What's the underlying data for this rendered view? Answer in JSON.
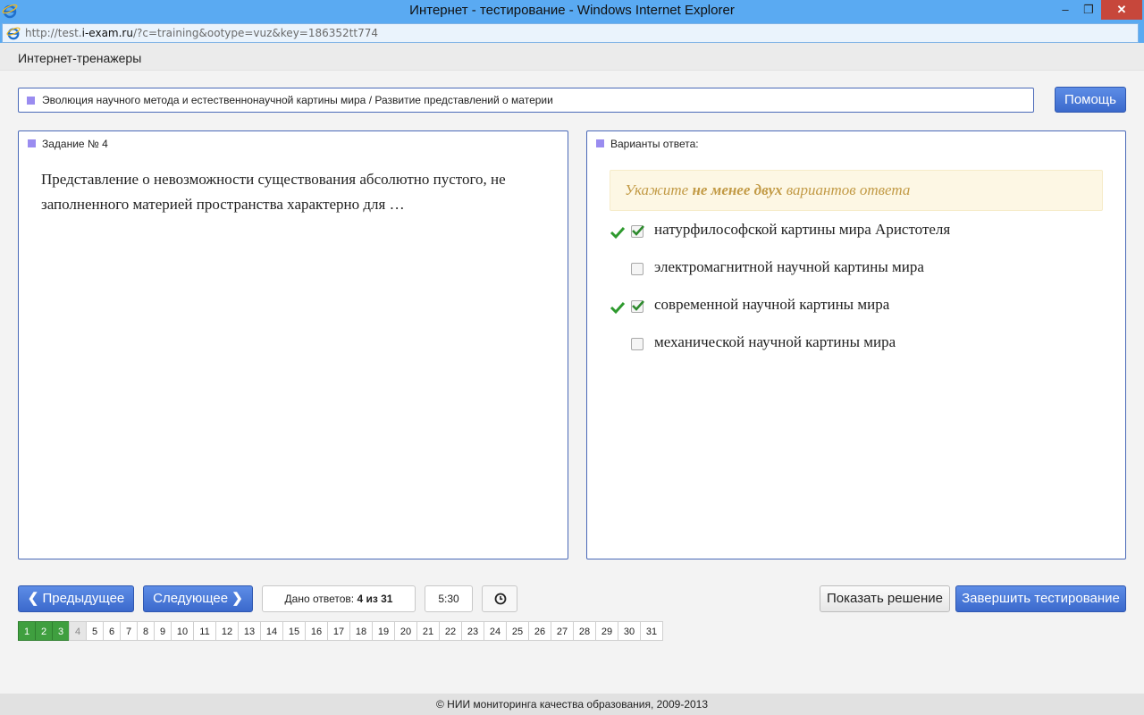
{
  "window": {
    "title": "Интернет - тестирование - Windows Internet Explorer",
    "minimize": "–",
    "maximize": "❐",
    "close": "✕"
  },
  "address": {
    "url_prefix": "http://test.",
    "url_domain": "i-exam.ru",
    "url_rest": "/?c=training&ootype=vuz&key=186352tt774"
  },
  "app": {
    "title": "Интернет-тренажеры"
  },
  "topic": {
    "text": "Эволюция научного метода и естественнонаучной картины мира / Развитие представлений о материи"
  },
  "help_label": "Помощь",
  "task": {
    "title": "Задание № 4",
    "question": "Представление о невозможности существования абсолютно пустого, не заполненного материей пространства характерно для …"
  },
  "answers": {
    "title": "Варианты ответа:",
    "hint_pre": "Укажите ",
    "hint_bold": "не менее двух",
    "hint_post": " вариантов ответа",
    "options": [
      {
        "label": "натурфилософской картины мира Аристотеля",
        "checked": true
      },
      {
        "label": "электромагнитной научной картины мира",
        "checked": false
      },
      {
        "label": "современной научной картины мира",
        "checked": true
      },
      {
        "label": "механической научной картины мира",
        "checked": false
      }
    ]
  },
  "controls": {
    "prev_label": "Предыдущее",
    "next_label": "Следующее",
    "answered_label": "Дано ответов: ",
    "answered_value": "4 из 31",
    "timer": "5:30",
    "show_solution": "Показать решение",
    "finish": "Завершить тестирование"
  },
  "pager": {
    "pages": [
      "1",
      "2",
      "3",
      "4",
      "5",
      "6",
      "7",
      "8",
      "9",
      "10",
      "11",
      "12",
      "13",
      "14",
      "15",
      "16",
      "17",
      "18",
      "19",
      "20",
      "21",
      "22",
      "23",
      "24",
      "25",
      "26",
      "27",
      "28",
      "29",
      "30",
      "31"
    ],
    "done": [
      "1",
      "2",
      "3"
    ],
    "current": "4"
  },
  "footer": "© НИИ мониторинга качества образования, 2009-2013",
  "colors": {
    "accent": "#3b69cc",
    "done": "#3f9f3f",
    "hint_bg": "#fdf7e4",
    "close": "#c7473b"
  }
}
